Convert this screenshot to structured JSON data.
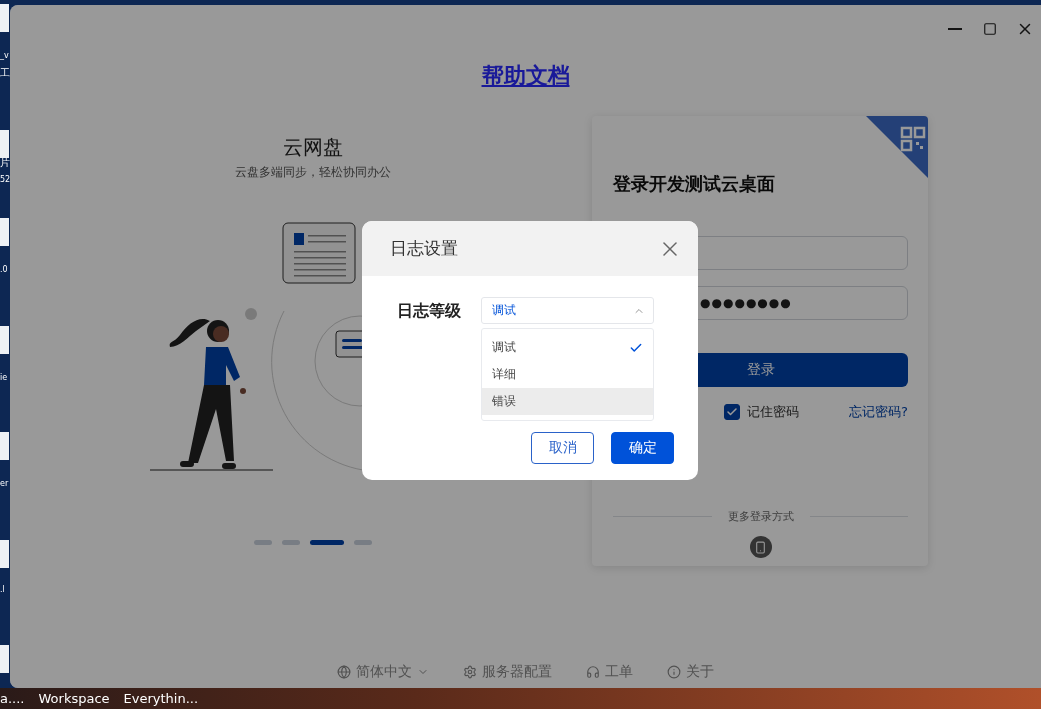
{
  "desktop": {
    "icon_labels": [
      "_v",
      "工",
      "片",
      "52",
      ".0",
      "ie",
      "er",
      ".l"
    ]
  },
  "taskbar": {
    "items": [
      "a....",
      "Workspace",
      "Everythin..."
    ]
  },
  "window": {
    "help_link": "帮助文档",
    "carousel": {
      "title": "云网盘",
      "subtitle": "云盘多端同步，轻松协同办公",
      "dots": [
        {
          "selected": false
        },
        {
          "selected": false
        },
        {
          "selected": true
        },
        {
          "selected": false
        }
      ]
    },
    "login": {
      "title": "登录开发测试云桌面",
      "password": "●●●●●●●●",
      "submit": "登录",
      "remember": {
        "label": "记住密码",
        "checked": true
      },
      "forgot": "忘记密码?",
      "more_methods": "更多登录方式"
    },
    "footer": [
      {
        "kind": "language",
        "label": "简体中文"
      },
      {
        "kind": "server",
        "label": "服务器配置"
      },
      {
        "kind": "ticket",
        "label": "工单"
      },
      {
        "kind": "about",
        "label": "关于"
      }
    ]
  },
  "dialog": {
    "title": "日志设置",
    "field_label": "日志等级",
    "select": {
      "value": "调试",
      "expanded": true,
      "options": [
        {
          "label": "调试",
          "selected": true,
          "highlighted": false
        },
        {
          "label": "详细",
          "selected": false,
          "highlighted": false
        },
        {
          "label": "错误",
          "selected": false,
          "highlighted": true
        }
      ]
    },
    "buttons": [
      {
        "kind": "secondary",
        "label": "取消"
      },
      {
        "kind": "primary",
        "label": "确定"
      }
    ]
  }
}
